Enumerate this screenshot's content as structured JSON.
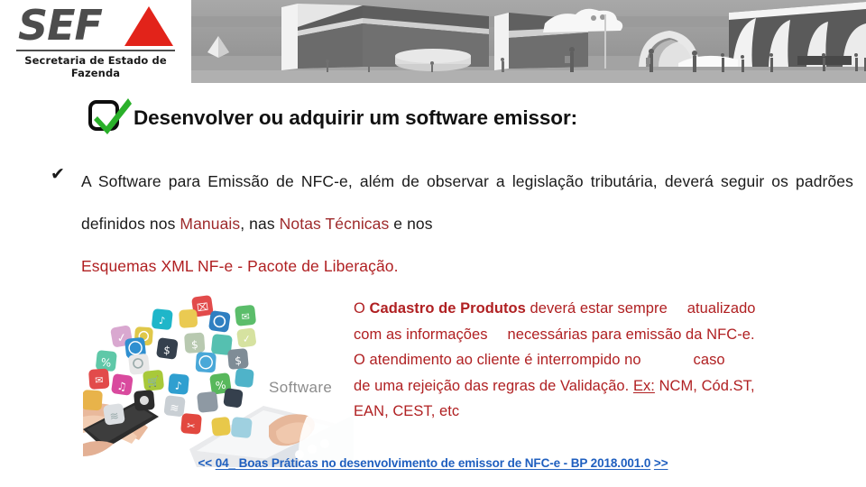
{
  "header": {
    "logo": {
      "wordmark": "SEF",
      "subtitle": "Secretaria de Estado de Fazenda"
    },
    "banner_alt": "architectural-illustration"
  },
  "title": {
    "icon": "checkbox-checked-icon",
    "text": "Desenvolver ou adquirir um software emissor:"
  },
  "bullet": {
    "marker": "✔",
    "seg1": "A  Software  para  Emissão  de  NFC-e,  além  de  observar  a  legislação  tributária,",
    "seg2_a": "deverá  seguir  os  padrões  definidos  nos  ",
    "seg2_manuais": "Manuais",
    "seg2_b": ",  nas  ",
    "seg2_notas": "Notas  Técnicas",
    "seg2_c": "  e  nos",
    "seg3": "Esquemas XML NF-e - Pacote de Liberação."
  },
  "photo": {
    "caption": "Software",
    "alt": "hands-with-phone-and-app-icons"
  },
  "red_block": {
    "l1_a": "O ",
    "l1_bold": "Cadastro de Produtos",
    "l1_b": " deverá estar sempre",
    "l1_c": "atualizado",
    "l2_a": "com as informações",
    "l2_b": "necessárias para emissão da NFC-e.",
    "l3_a": "O atendimento ao cliente é interrompido no",
    "l3_b": "caso",
    "l4_a": "de uma rejeição das regras de Validação. ",
    "l4_underline": "Ex:",
    "l4_b": " NCM, Cód.ST,",
    "l5": "EAN, CEST, etc"
  },
  "bottom_link": {
    "prefix": "<<",
    "label": "04_ Boas Práticas no desenvolvimento de emissor de NFC-e - BP 2018.001.0",
    "suffix": ">>"
  },
  "colors": {
    "brand_red": "#e2231a",
    "text_red": "#b02022",
    "muted_red": "#9e2a2b",
    "link_blue": "#1f5fbf",
    "check_green": "#2ab02a",
    "logo_gray": "#4d4d4d"
  }
}
